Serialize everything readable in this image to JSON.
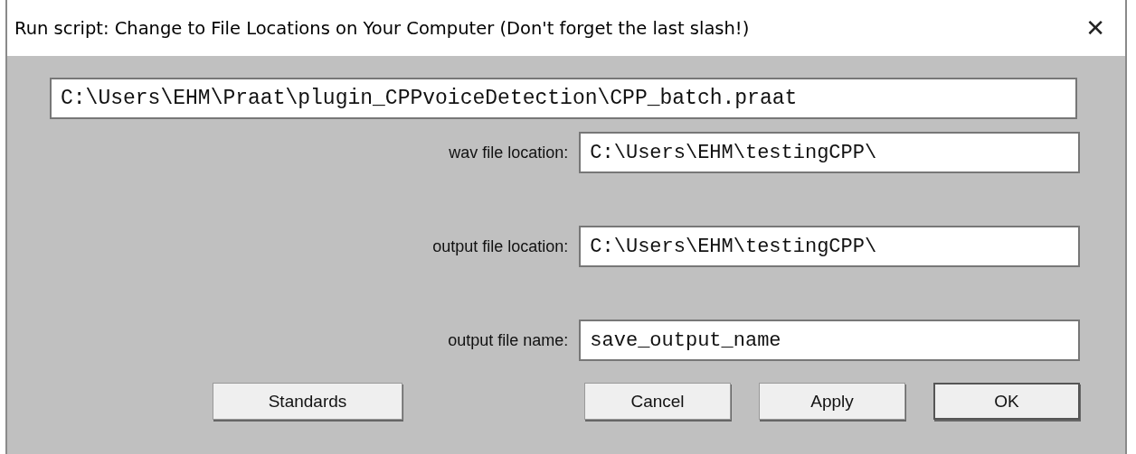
{
  "window": {
    "title": "Run script: Change to File Locations on Your Computer (Don't forget the last slash!)",
    "close": "✕"
  },
  "script_path": {
    "value": "C:\\Users\\EHM\\Praat\\plugin_CPPvoiceDetection\\CPP_batch.praat"
  },
  "fields": [
    {
      "label": "wav file location:",
      "value": "C:\\Users\\EHM\\testingCPP\\"
    },
    {
      "label": "output file location:",
      "value": "C:\\Users\\EHM\\testingCPP\\"
    },
    {
      "label": "output file name:",
      "value": "save_output_name"
    }
  ],
  "buttons": [
    {
      "label": "Standards",
      "kind": "left",
      "default": false
    },
    {
      "label": "Cancel",
      "kind": "right",
      "default": false
    },
    {
      "label": "Apply",
      "kind": "right",
      "default": false
    },
    {
      "label": "OK",
      "kind": "right",
      "default": true
    }
  ]
}
